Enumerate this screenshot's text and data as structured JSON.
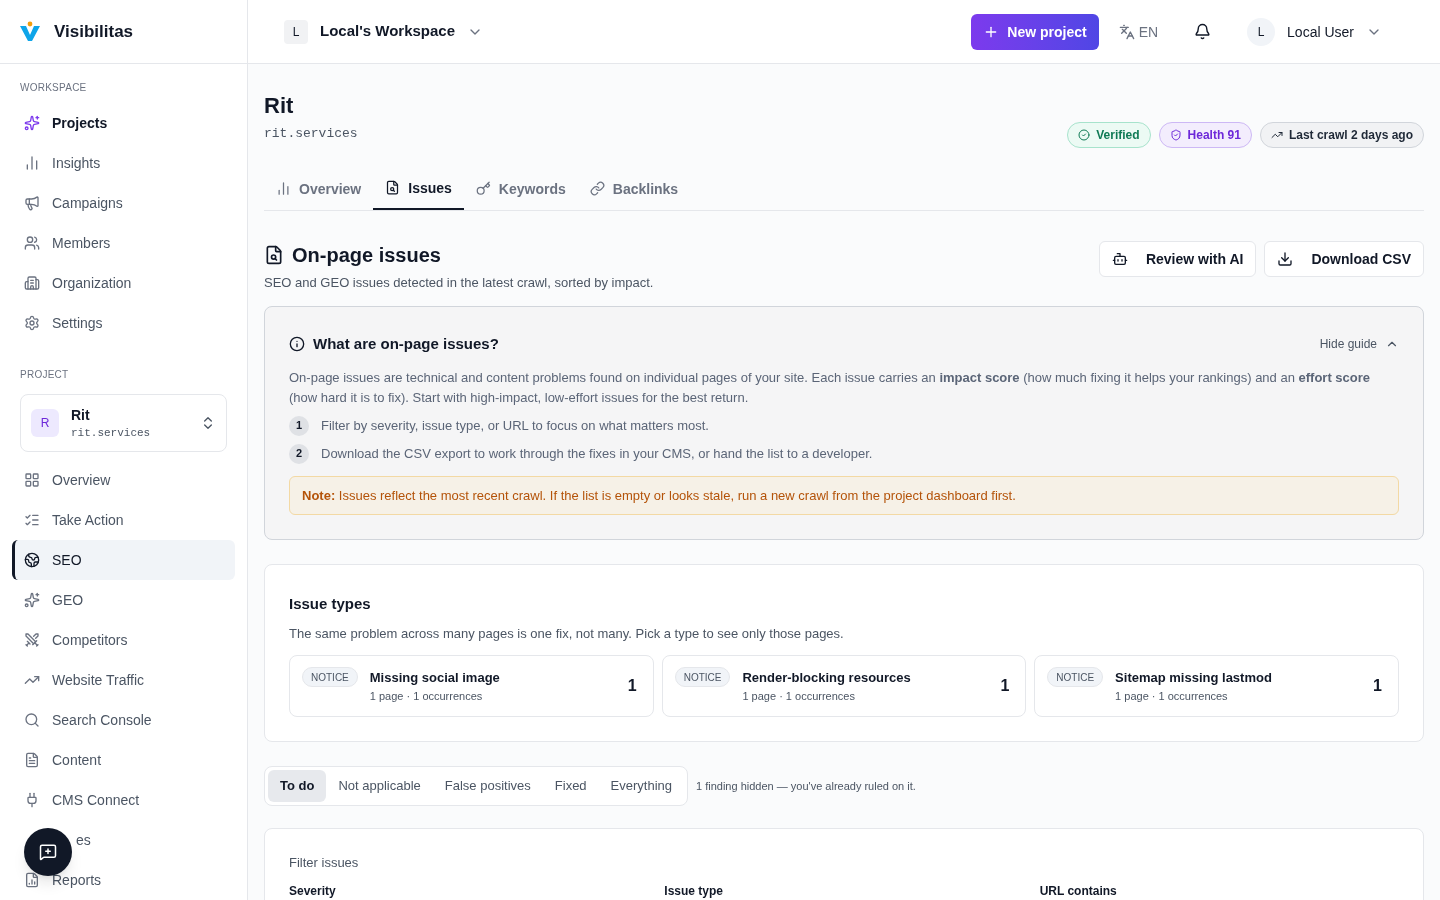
{
  "brand": {
    "name": "Visibilitas"
  },
  "workspace": {
    "initial": "L",
    "name": "Local's Workspace"
  },
  "header": {
    "new_project": "New project",
    "language": "EN",
    "user": {
      "initial": "L",
      "name": "Local User"
    }
  },
  "sidebar": {
    "workspace_heading": "WORKSPACE",
    "workspace_items": [
      {
        "label": "Projects",
        "selected": true
      },
      {
        "label": "Insights",
        "selected": false
      },
      {
        "label": "Campaigns",
        "selected": false
      },
      {
        "label": "Members",
        "selected": false
      },
      {
        "label": "Organization",
        "selected": false
      },
      {
        "label": "Settings",
        "selected": false
      }
    ],
    "project_heading": "PROJECT",
    "project": {
      "initial": "R",
      "name": "Rit",
      "domain": "rit.services"
    },
    "project_items": [
      {
        "label": "Overview",
        "selected": false,
        "kind": "item"
      },
      {
        "label": "Take Action",
        "selected": false,
        "kind": "item"
      },
      {
        "label": "SEO",
        "selected": true,
        "kind": "item"
      },
      {
        "label": "GEO",
        "selected": false,
        "kind": "item"
      },
      {
        "label": "Competitors",
        "selected": false,
        "kind": "item"
      },
      {
        "label": "Website Traffic",
        "selected": false,
        "kind": "item"
      },
      {
        "label": "Search Console",
        "selected": false,
        "kind": "item"
      },
      {
        "label": "Content",
        "selected": false,
        "kind": "item"
      },
      {
        "label": "CMS Connect",
        "selected": false,
        "kind": "item"
      },
      {
        "label": "es",
        "selected": false,
        "kind": "covered"
      },
      {
        "label": "Reports",
        "selected": false,
        "kind": "item"
      }
    ]
  },
  "page": {
    "title": "Rit",
    "domain": "rit.services",
    "badges": [
      {
        "label": "Verified",
        "kind": "verified"
      },
      {
        "label": "Health 91",
        "kind": "health"
      },
      {
        "label": "Last crawl 2 days ago",
        "kind": "crawl"
      }
    ],
    "tabs": [
      {
        "label": "Overview",
        "selected": false
      },
      {
        "label": "Issues",
        "selected": true
      },
      {
        "label": "Keywords",
        "selected": false
      },
      {
        "label": "Backlinks",
        "selected": false
      }
    ]
  },
  "section": {
    "title": "On-page issues",
    "subtitle": "SEO and GEO issues detected in the latest crawl, sorted by impact.",
    "actions": [
      "Review with AI",
      "Download CSV"
    ]
  },
  "guide": {
    "title": "What are on-page issues?",
    "toggle": "Hide guide",
    "expanded": true,
    "text": "On-page issues are technical and content problems found on individual pages of your site. Each issue carries an **impact score** (how much fixing it helps your rankings) and an **effort score** (how hard it is to fix). Start with high-impact, low-effort issues for the best return.",
    "steps": [
      {
        "number": "1",
        "text": "Filter by severity, issue type, or URL to focus on what matters most."
      },
      {
        "number": "2",
        "text": "Download the CSV export to work through the fixes in your CMS, or hand the list to a developer."
      }
    ],
    "note": "**Note:** Issues reflect the most recent crawl. If the list is empty or looks stale, run a new crawl from the project dashboard first."
  },
  "issue_types": {
    "title": "Issue types",
    "subtitle": "The same problem across many pages is one fix, not many. Pick a type to see only those pages.",
    "items": [
      {
        "severity": "NOTICE",
        "name": "Missing social image",
        "meta": "1 page · 1 occurrences",
        "count": "1"
      },
      {
        "severity": "NOTICE",
        "name": "Render-blocking resources",
        "meta": "1 page · 1 occurrences",
        "count": "1"
      },
      {
        "severity": "NOTICE",
        "name": "Sitemap missing lastmod",
        "meta": "1 page · 1 occurrences",
        "count": "1"
      }
    ]
  },
  "status_tabs": [
    {
      "label": "To do",
      "selected": true
    },
    {
      "label": "Not applicable",
      "selected": false
    },
    {
      "label": "False positives",
      "selected": false
    },
    {
      "label": "Fixed",
      "selected": false
    },
    {
      "label": "Everything",
      "selected": false
    }
  ],
  "hidden_note": "1 finding hidden — you've already ruled on it.",
  "filters": {
    "title": "Filter issues",
    "fields": [
      "Severity",
      "Issue type",
      "URL contains"
    ]
  }
}
